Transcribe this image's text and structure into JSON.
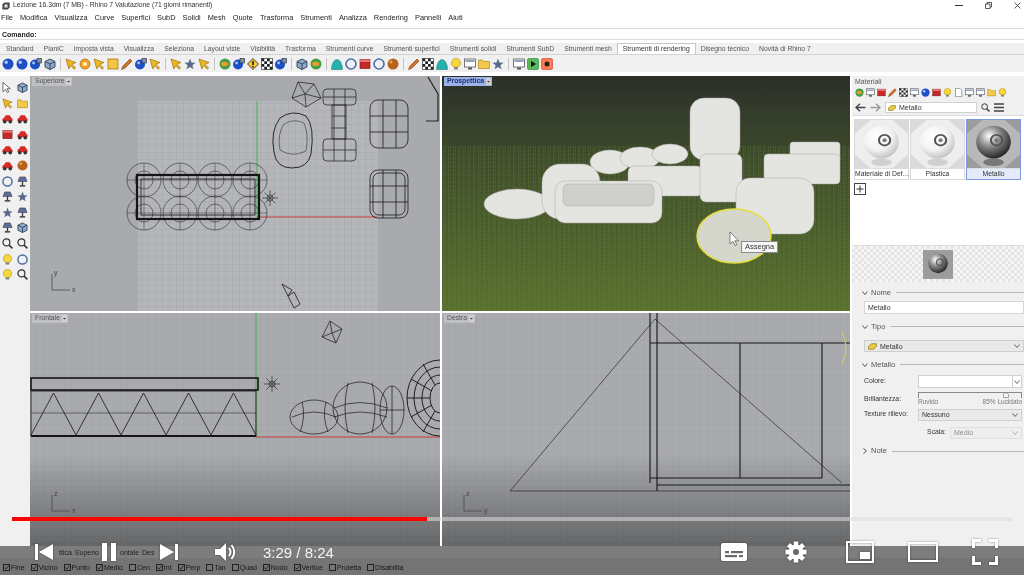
{
  "window": {
    "title": "Lezione 16.3dm (7 MB) - Rhino 7 Valutazione (71 giorni rimanenti)"
  },
  "menu": [
    "File",
    "Modifica",
    "Visualizza",
    "Curve",
    "Superfici",
    "SubD",
    "Solidi",
    "Mesh",
    "Quote",
    "Trasforma",
    "Strumenti",
    "Analizza",
    "Rendering",
    "Pannelli",
    "Aiuti"
  ],
  "command": {
    "label": "Comando:"
  },
  "toolbar_tabs": [
    {
      "label": "Standard",
      "selected": false
    },
    {
      "label": "PianiC",
      "selected": false
    },
    {
      "label": "Imposta vista",
      "selected": false
    },
    {
      "label": "Visualizza",
      "selected": false
    },
    {
      "label": "Seleziona",
      "selected": false
    },
    {
      "label": "Layout viste",
      "selected": false
    },
    {
      "label": "Visibilità",
      "selected": false
    },
    {
      "label": "Trasforma",
      "selected": false
    },
    {
      "label": "Strumenti curve",
      "selected": false
    },
    {
      "label": "Strumenti superfici",
      "selected": false
    },
    {
      "label": "Strumenti solidi",
      "selected": false
    },
    {
      "label": "Strumenti SubD",
      "selected": false
    },
    {
      "label": "Strumenti mesh",
      "selected": false
    },
    {
      "label": "Strumenti di rendering",
      "selected": true
    },
    {
      "label": "Disegno tecnico",
      "selected": false
    },
    {
      "label": "Novità di Rhino 7",
      "selected": false
    }
  ],
  "viewports": [
    {
      "label": "Superiore",
      "selected": false,
      "kind": "top",
      "axes": [
        "y",
        "x"
      ]
    },
    {
      "label": "Prospettica",
      "selected": true,
      "kind": "perspective",
      "tooltip": "Assegna"
    },
    {
      "label": "Frontale",
      "selected": false,
      "kind": "front",
      "axes": [
        "z",
        "x"
      ]
    },
    {
      "label": "Destra",
      "selected": false,
      "kind": "right",
      "axes": [
        "z",
        "y"
      ]
    }
  ],
  "viewport_tabs": [
    "ttica",
    "Superio",
    "ontale",
    "Des"
  ],
  "materials_panel": {
    "title": "Materiali",
    "breadcrumb": "Metallo",
    "materials": [
      {
        "name": "Materiale di Def…",
        "kind": "plastic",
        "selected": false
      },
      {
        "name": "Plastica",
        "kind": "plastic",
        "selected": false
      },
      {
        "name": "Metallo",
        "kind": "metal",
        "selected": true
      }
    ],
    "sections": [
      {
        "kind": "text",
        "title": "Nome",
        "expanded": true,
        "value": "Metallo"
      },
      {
        "kind": "type",
        "title": "Tipo",
        "expanded": true,
        "value": "Metallo"
      },
      {
        "kind": "properties",
        "title": "Metallo",
        "expanded": true,
        "fields": [
          {
            "kind": "color",
            "label": "Colore:"
          },
          {
            "kind": "slider",
            "label": "Brillantezza:",
            "level": 0.85,
            "min_label": "Ruvido",
            "max_label": "85% Lucidato"
          },
          {
            "kind": "dropdown",
            "label": "Texture rilievo:",
            "value": "Nessuno",
            "disabled": false
          },
          {
            "kind": "dropdown",
            "label": "Scala:",
            "value": "Medio",
            "disabled": true
          }
        ]
      },
      {
        "kind": "notes",
        "title": "Note",
        "expanded": false
      }
    ]
  },
  "snaps": [
    {
      "label": "Fine",
      "checked": true
    },
    {
      "label": "Vicino",
      "checked": true
    },
    {
      "label": "Punto",
      "checked": true
    },
    {
      "label": "Medio",
      "checked": true
    },
    {
      "label": "Cen",
      "checked": false
    },
    {
      "label": "Int",
      "checked": true
    },
    {
      "label": "Perp",
      "checked": true
    },
    {
      "label": "Tan",
      "checked": false
    },
    {
      "label": "Quad",
      "checked": false
    },
    {
      "label": "Nodo",
      "checked": true
    },
    {
      "label": "Vertice",
      "checked": true
    },
    {
      "label": "Proietta",
      "checked": false
    },
    {
      "label": "Disabilita",
      "checked": false
    }
  ],
  "player": {
    "level": 0.415,
    "time": "3:29 / 8:24"
  }
}
